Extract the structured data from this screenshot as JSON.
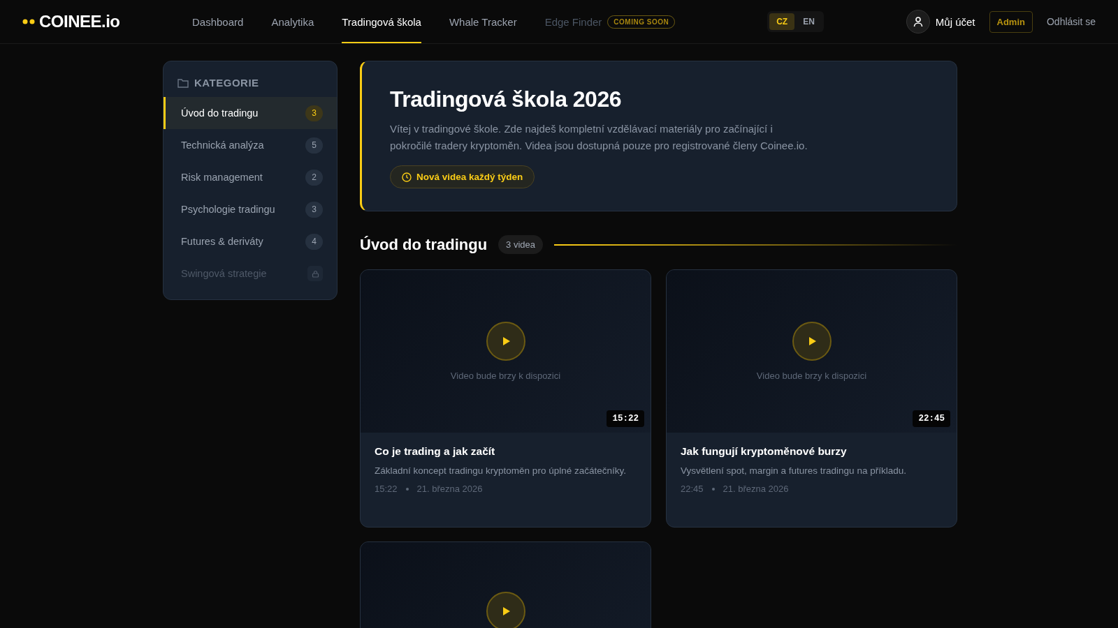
{
  "logo": {
    "text": "COINEE.io"
  },
  "nav": [
    {
      "label": "Dashboard",
      "selected": false,
      "disabled": false
    },
    {
      "label": "Analytika",
      "selected": false,
      "disabled": false
    },
    {
      "label": "Tradingová škola",
      "selected": true,
      "disabled": false
    },
    {
      "label": "Whale Tracker",
      "selected": false,
      "disabled": false
    },
    {
      "label": "Edge Finder",
      "selected": false,
      "disabled": true,
      "badge": "COMING SOON"
    }
  ],
  "languages": [
    {
      "label": "CZ",
      "selected": true
    },
    {
      "label": "EN",
      "selected": false
    }
  ],
  "account": {
    "label": "Můj účet",
    "admin": "Admin",
    "logout": "Odhlásit se"
  },
  "sidebar": {
    "title": "KATEGORIE",
    "items": [
      {
        "label": "Úvod do tradingu",
        "count": "3",
        "selected": true,
        "locked": false
      },
      {
        "label": "Technická analýza",
        "count": "5",
        "selected": false,
        "locked": false
      },
      {
        "label": "Risk management",
        "count": "2",
        "selected": false,
        "locked": false
      },
      {
        "label": "Psychologie tradingu",
        "count": "3",
        "selected": false,
        "locked": false
      },
      {
        "label": "Futures & deriváty",
        "count": "4",
        "selected": false,
        "locked": false
      },
      {
        "label": "Swingová strategie",
        "selected": false,
        "locked": true
      }
    ]
  },
  "banner": {
    "title": "Tradingová škola 2026",
    "text": "Vítej v tradingové škole. Zde najdeš kompletní vzdělávací materiály pro začínající i pokročilé tradery kryptoměn. Videa jsou dostupná pouze pro registrované členy Coinee.io.",
    "badge": "Nová videa každý týden"
  },
  "section": {
    "title": "Úvod do tradingu",
    "count": "3 videa"
  },
  "videos": [
    {
      "placeholder": "Video bude brzy k dispozici",
      "duration": "15:22",
      "title": "Co je trading a jak začít",
      "description": "Základní koncept tradingu kryptoměn pro úplné začátečníky.",
      "meta_duration": "15:22",
      "date": "21. března 2026"
    },
    {
      "placeholder": "Video bude brzy k dispozici",
      "duration": "22:45",
      "title": "Jak fungují kryptoměnové burzy",
      "description": "Vysvětlení spot, margin a futures tradingu na příkladu.",
      "meta_duration": "22:45",
      "date": "21. března 2026"
    },
    {
      "kind": "partial"
    }
  ]
}
